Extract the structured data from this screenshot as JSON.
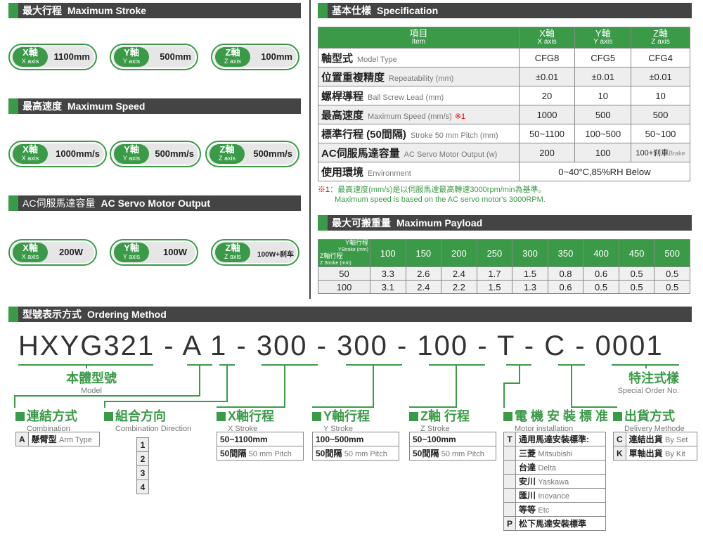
{
  "sections": {
    "stroke": {
      "zh": "最大行程",
      "en": "Maximum Stroke"
    },
    "speed": {
      "zh": "最高速度",
      "en": "Maximum Speed"
    },
    "motor": {
      "zh": "AC伺服馬達容量",
      "en": "AC Servo Motor Output"
    },
    "spec": {
      "zh": "基本仕樣",
      "en": "Specification"
    },
    "payload": {
      "zh": "最大可搬重量",
      "en": "Maximum Payload"
    },
    "ordering": {
      "zh": "型號表示方式",
      "en": "Ordering Method"
    }
  },
  "axes": [
    {
      "zh": "X軸",
      "en": "X axis"
    },
    {
      "zh": "Y軸",
      "en": "Y axis"
    },
    {
      "zh": "Z軸",
      "en": "Z axis"
    }
  ],
  "stroke_values": [
    "1100mm",
    "500mm",
    "100mm"
  ],
  "speed_values": [
    "1000mm/s",
    "500mm/s",
    "500mm/s"
  ],
  "motor_values": [
    "200W",
    "100W",
    "100W+刹车"
  ],
  "spec_table": {
    "head": {
      "item_zh": "項目",
      "item_en": "Item"
    },
    "cols": [
      {
        "zh": "X軸",
        "en": "X axis"
      },
      {
        "zh": "Y軸",
        "en": "Y axis"
      },
      {
        "zh": "Z軸",
        "en": "Z axis"
      }
    ],
    "rows": [
      {
        "zh": "軸型式",
        "en": "Model Type",
        "v": [
          "CFG8",
          "CFG5",
          "CFG4"
        ]
      },
      {
        "zh": "位置重複精度",
        "en": "Repeatability (mm)",
        "v": [
          "±0.01",
          "±0.01",
          "±0.01"
        ]
      },
      {
        "zh": "螺桿導程",
        "en": "Ball Screw Lead (mm)",
        "v": [
          "20",
          "10",
          "10"
        ]
      },
      {
        "zh": "最高速度",
        "en": "Maximum Speed (mm/s)",
        "mark": "※1",
        "v": [
          "1000",
          "500",
          "500"
        ]
      },
      {
        "zh": "標準行程 (50間隔)",
        "en": "Stroke 50 mm Pitch (mm)",
        "v": [
          "50~1100",
          "100~500",
          "50~100"
        ]
      },
      {
        "zh": "AC伺服馬達容量",
        "en": "AC Servo Motor Output (w)",
        "v": [
          "200",
          "100",
          "100+刹車"
        ],
        "brake": "Brake"
      },
      {
        "zh": "使用環境",
        "en": "Environment",
        "span": "0~40°C,85%RH Below"
      }
    ]
  },
  "note": {
    "mark": "※1",
    "zh": "：最高速度(mm/s)是以伺服馬達最高轉速3000rpm/min為基準。",
    "en": "Maximum speed is based on the AC servo motor's 3000RPM."
  },
  "payload_table": {
    "corner_y": "Y軸行程",
    "corner_y_en": "YStroke (mm)",
    "corner_z": "Z軸行程",
    "corner_z_en": "Z Stroke (mm)",
    "cols": [
      "100",
      "150",
      "200",
      "250",
      "300",
      "350",
      "400",
      "450",
      "500"
    ],
    "rows": [
      {
        "h": "50",
        "v": [
          "3.3",
          "2.6",
          "2.4",
          "1.7",
          "1.5",
          "0.8",
          "0.6",
          "0.5",
          "0.5"
        ]
      },
      {
        "h": "100",
        "v": [
          "3.1",
          "2.4",
          "2.2",
          "1.5",
          "1.3",
          "0.6",
          "0.5",
          "0.5",
          "0.5"
        ]
      }
    ]
  },
  "code": "HXYG321 - A 1 - 300 - 300 - 100 - T - C - 0001",
  "groups": {
    "body": {
      "zh": "本體型號",
      "en": "Model"
    },
    "special": {
      "zh": "特注式樣",
      "en": "Special Order No."
    },
    "combination": {
      "zh": "連結方式",
      "en": "Combination"
    },
    "direction": {
      "zh": "組合方向",
      "en": "Combination Direction"
    },
    "xs": {
      "zh": "X軸行程",
      "en": "X Stroke"
    },
    "ys": {
      "zh": "Y軸行程",
      "en": "Y Stroke"
    },
    "zs": {
      "zh": "Z軸 行程",
      "en": "Z Stroke"
    },
    "mi": {
      "zh": "電 機 安 裝 標 准",
      "en": "Motor installation"
    },
    "dm": {
      "zh": "出貨方式",
      "en": "Delivery Methode"
    }
  },
  "combination_opts": [
    {
      "k": "A",
      "zh": "懸臂型",
      "en": "Arm Type"
    }
  ],
  "direction_opts": [
    "1",
    "2",
    "3",
    "4"
  ],
  "xs_opts": [
    {
      "zh": "50~1100mm",
      "en": ""
    },
    {
      "zh": "50間隔",
      "en": "50 mm Pitch"
    }
  ],
  "ys_opts": [
    {
      "zh": "100~500mm",
      "en": ""
    },
    {
      "zh": "50間隔",
      "en": "50 mm Pitch"
    }
  ],
  "zs_opts": [
    {
      "zh": "50~100mm",
      "en": ""
    },
    {
      "zh": "50間隔",
      "en": "50 mm Pitch"
    }
  ],
  "mi_opts": [
    {
      "k": "T",
      "zh": "通用馬達安裝標準:",
      "en": ""
    },
    {
      "k": "",
      "zh": "三菱",
      "en": "Mitsubishi"
    },
    {
      "k": "",
      "zh": "台達",
      "en": "Delta"
    },
    {
      "k": "",
      "zh": "安川",
      "en": "Yaskawa"
    },
    {
      "k": "",
      "zh": "匯川",
      "en": "Inovance"
    },
    {
      "k": "",
      "zh": "等等",
      "en": "Etc"
    },
    {
      "k": "P",
      "zh": "松下馬達安裝標準",
      "en": ""
    }
  ],
  "dm_opts": [
    {
      "k": "C",
      "zh": "連結出貨",
      "en": "By Set"
    },
    {
      "k": "K",
      "zh": "單軸出貨",
      "en": "By Kit"
    }
  ]
}
